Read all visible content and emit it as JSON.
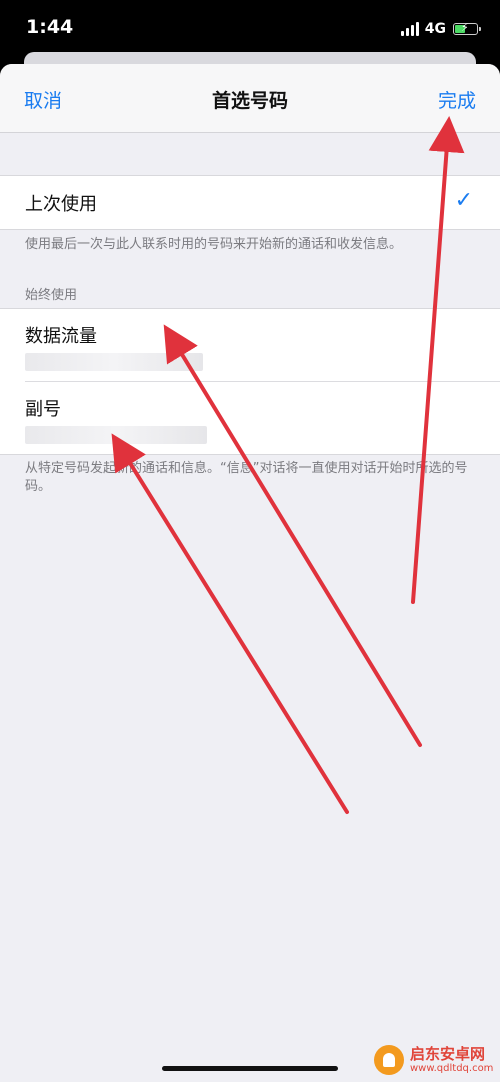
{
  "status": {
    "time": "1:44",
    "network": "4G"
  },
  "navbar": {
    "cancel_label": "取消",
    "title": "首选号码",
    "done_label": "完成"
  },
  "last_used": {
    "label": "上次使用",
    "checked": true,
    "footer": "使用最后一次与此人联系时用的号码来开始新的通话和收发信息。"
  },
  "always_use": {
    "header": "始终使用",
    "items": [
      {
        "label": "数据流量"
      },
      {
        "label": "副号"
      }
    ],
    "footer": "从特定号码发起新的通话和信息。“信息”对话将一直使用对话开始时所选的号码。"
  },
  "watermark": {
    "name": "启东安卓网",
    "url": "www.qdltdq.com"
  },
  "colors": {
    "accent": "#1a7cf0",
    "annotation_arrow": "#e0323c",
    "background": "#efeff4"
  }
}
